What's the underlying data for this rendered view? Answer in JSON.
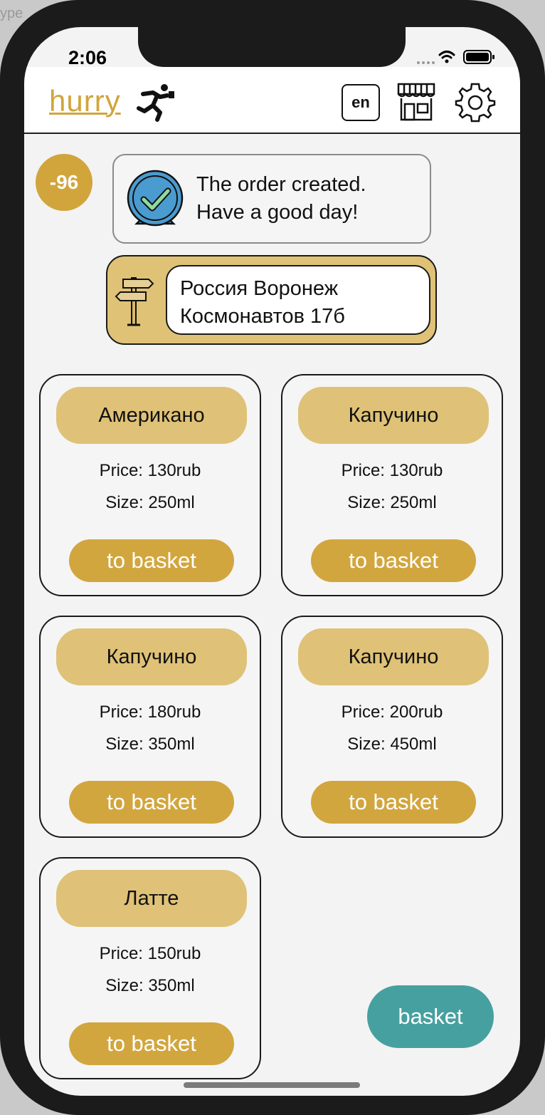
{
  "background": {
    "hint_text": "ype"
  },
  "status_bar": {
    "time": "2:06"
  },
  "header": {
    "logo_text": "hurry",
    "language": "en",
    "icons": [
      "runner-icon",
      "shop-icon",
      "gear-icon"
    ]
  },
  "balance": "-96",
  "notice": {
    "line1": "The order created.",
    "line2": "Have a good day!"
  },
  "address": {
    "line1": "Россия Воронеж",
    "line2": "Космонавтов 17б"
  },
  "products": [
    {
      "name": "Американо",
      "price": "Price: 130rub",
      "size": "Size: 250ml",
      "button": "to basket"
    },
    {
      "name": "Капучино",
      "price": "Price: 130rub",
      "size": "Size: 250ml",
      "button": "to basket"
    },
    {
      "name": "Капучино",
      "price": "Price: 180rub",
      "size": "Size: 350ml",
      "button": "to basket"
    },
    {
      "name": "Капучино",
      "price": "Price: 200rub",
      "size": "Size: 450ml",
      "button": "to basket"
    },
    {
      "name": "Латте",
      "price": "Price: 150rub",
      "size": "Size: 350ml",
      "button": "to basket"
    }
  ],
  "basket_button": "basket",
  "colors": {
    "accent_gold": "#d1a53c",
    "light_gold": "#dfc277",
    "teal": "#47a0a0",
    "check_blue": "#4a9bd0"
  }
}
